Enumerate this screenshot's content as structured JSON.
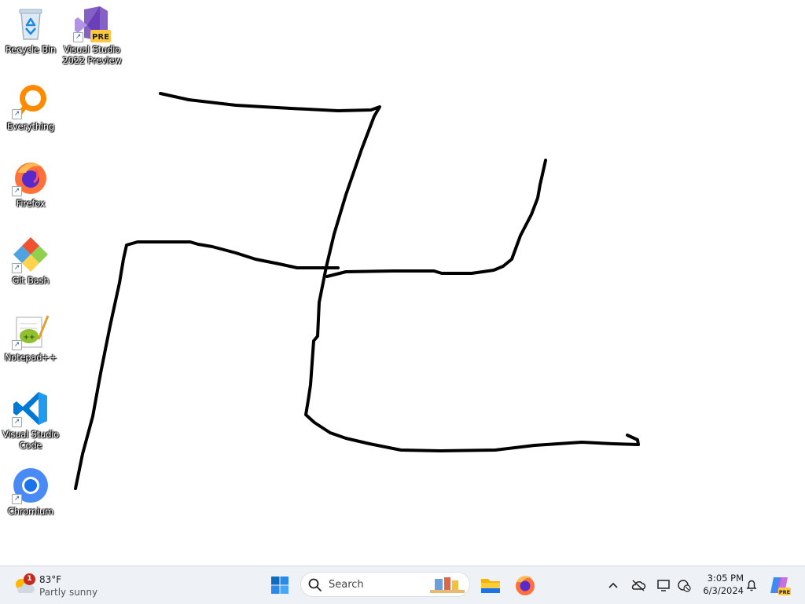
{
  "desktop": {
    "icons": [
      {
        "label": "Recycle Bin",
        "icon": "recycle-bin-icon"
      },
      {
        "label": "Visual Studio 2022 Preview",
        "icon": "visual-studio-icon",
        "badge": "PRE"
      },
      {
        "label": "Everything",
        "icon": "everything-search-icon"
      },
      {
        "label": "Firefox",
        "icon": "firefox-icon"
      },
      {
        "label": "Git Bash",
        "icon": "git-bash-icon"
      },
      {
        "label": "Notepad++",
        "icon": "notepad-plus-plus-icon"
      },
      {
        "label": "Visual Studio Code",
        "icon": "vscode-icon"
      },
      {
        "label": "Chromium",
        "icon": "chromium-icon"
      }
    ]
  },
  "taskbar": {
    "weather": {
      "temp": "83°F",
      "condition": "Partly sunny",
      "badge_count": "1"
    },
    "search": {
      "placeholder": "Search"
    },
    "apps": [
      "start-icon",
      "file-explorer-icon",
      "firefox-icon"
    ],
    "tray_icons": [
      "chevron-up-icon",
      "network-icon",
      "display-icon",
      "onedrive-icon",
      "notification-bell-icon",
      "copilot-icon"
    ],
    "clock": {
      "time": "3:05 PM",
      "date": "6/3/2024"
    }
  },
  "colors": {
    "desktop_background": "#ffffff",
    "taskbar_background": "#eef1f5",
    "stroke": "#000000",
    "accent": "#0067c0"
  }
}
